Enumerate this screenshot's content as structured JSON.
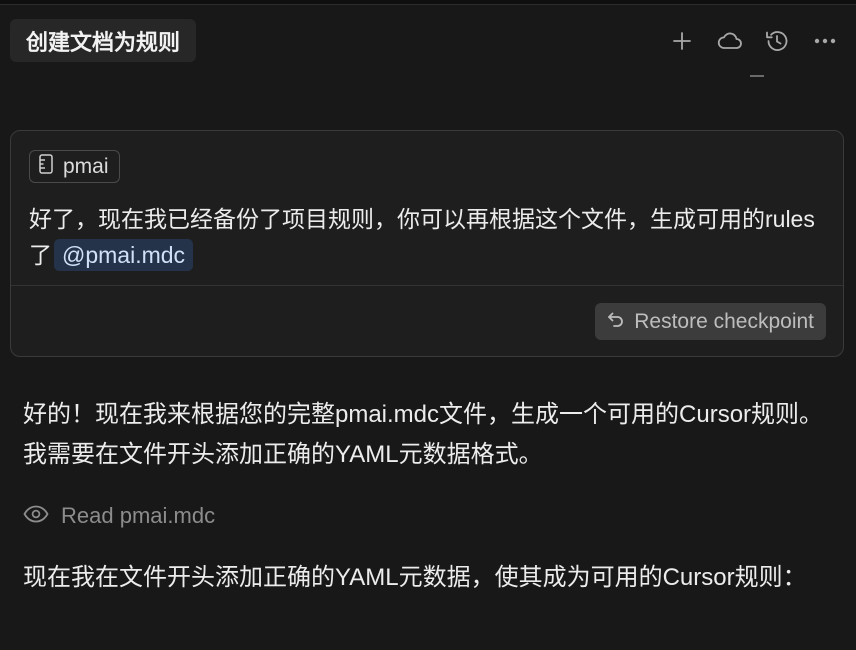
{
  "header": {
    "title": "创建文档为规则",
    "actions": [
      {
        "name": "new-chat-icon"
      },
      {
        "name": "cloud-icon"
      },
      {
        "name": "history-icon"
      },
      {
        "name": "more-icon"
      }
    ]
  },
  "user_message": {
    "context_chip": {
      "icon": "ruler-icon",
      "label": "pmai"
    },
    "text": "好了，现在我已经备份了项目规则，你可以再根据这个文件，生成可用的rules了",
    "mention": "@pmai.mdc",
    "restore_button": {
      "icon": "undo-icon",
      "label": "Restore checkpoint"
    }
  },
  "assistant": {
    "paragraph1": "好的！现在我来根据您的完整pmai.mdc文件，生成一个可用的Cursor规则。我需要在文件开头添加正确的YAML元数据格式。",
    "tool_read": {
      "icon": "eye-icon",
      "label": "Read pmai.mdc"
    },
    "paragraph2": "现在我在文件开头添加正确的YAML元数据，使其成为可用的Cursor规则："
  }
}
